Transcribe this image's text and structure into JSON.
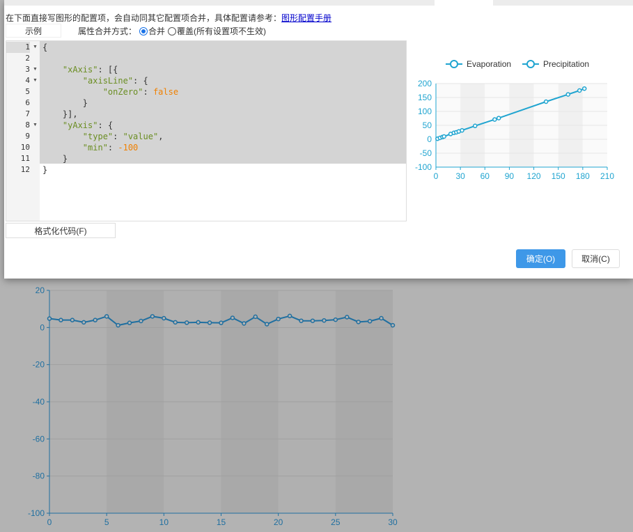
{
  "dialog": {
    "instruction": "在下面直接写图形的配置项，会自动同其它配置项合并，具体配置请参考：",
    "manual_link": "图形配置手册",
    "example_button": "示例",
    "merge_label": "属性合并方式：",
    "merge_option": "合并",
    "override_option": "覆盖(所有设置项不生效)",
    "format_button": "格式化代码(F)",
    "ok_button": "确定(O)",
    "cancel_button": "取消(C)"
  },
  "editor": {
    "line_numbers": [
      "1",
      "2",
      "3",
      "4",
      "5",
      "6",
      "7",
      "8",
      "9",
      "10",
      "11",
      "12"
    ],
    "fold_lines": [
      1,
      3,
      4,
      8
    ],
    "lines": [
      [
        [
          "p",
          "{"
        ]
      ],
      [],
      [
        [
          "p",
          "    "
        ],
        [
          "k",
          "\"xAxis\""
        ],
        [
          "p",
          ": [{"
        ]
      ],
      [
        [
          "p",
          "        "
        ],
        [
          "k",
          "\"axisLine\""
        ],
        [
          "p",
          ": {"
        ]
      ],
      [
        [
          "p",
          "            "
        ],
        [
          "k",
          "\"onZero\""
        ],
        [
          "p",
          ": "
        ],
        [
          "b",
          "false"
        ]
      ],
      [
        [
          "p",
          "        }"
        ]
      ],
      [
        [
          "p",
          "    }],"
        ]
      ],
      [
        [
          "p",
          "    "
        ],
        [
          "k",
          "\"yAxis\""
        ],
        [
          "p",
          ": {"
        ]
      ],
      [
        [
          "p",
          "        "
        ],
        [
          "k",
          "\"type\""
        ],
        [
          "p",
          ": "
        ],
        [
          "k",
          "\"value\""
        ],
        [
          "p",
          ","
        ]
      ],
      [
        [
          "p",
          "        "
        ],
        [
          "k",
          "\"min\""
        ],
        [
          "p",
          ": "
        ],
        [
          "b",
          "-100"
        ]
      ],
      [
        [
          "p",
          "    }"
        ]
      ],
      [
        [
          "p",
          "}"
        ]
      ]
    ]
  },
  "colors": {
    "accent": "#3e98e8",
    "preview_series": "#1fa4d0",
    "bg_series": "#1f6fa0"
  },
  "chart_data": [
    {
      "type": "scatter",
      "legend": [
        "Evaporation",
        "Precipitation"
      ],
      "legend_position": "top",
      "xlim": [
        0,
        210
      ],
      "xticks": [
        "0",
        "30",
        "60",
        "90",
        "120",
        "150",
        "180",
        "210"
      ],
      "ylim": [
        -100,
        200
      ],
      "yticks": [
        "200",
        "150",
        "100",
        "50",
        "0",
        "-50",
        "-100"
      ],
      "points": [
        [
          2,
          2
        ],
        [
          5,
          5
        ],
        [
          8,
          8
        ],
        [
          10,
          10
        ],
        [
          18,
          19
        ],
        [
          22,
          23
        ],
        [
          25,
          25
        ],
        [
          28,
          28
        ],
        [
          32,
          32
        ],
        [
          48,
          48
        ],
        [
          72,
          71
        ],
        [
          77,
          76
        ],
        [
          135,
          135
        ],
        [
          162,
          161
        ],
        [
          176,
          175
        ],
        [
          182,
          182
        ]
      ]
    },
    {
      "type": "line",
      "xlim": [
        0,
        30
      ],
      "xticks": [
        "0",
        "5",
        "10",
        "15",
        "20",
        "25",
        "30"
      ],
      "ylim": [
        -100,
        20
      ],
      "yticks": [
        "20",
        "0",
        "-20",
        "-40",
        "-60",
        "-80",
        "-100"
      ],
      "x": [
        0,
        1,
        2,
        3,
        4,
        5,
        6,
        7,
        8,
        9,
        10,
        11,
        12,
        13,
        14,
        15,
        16,
        17,
        18,
        19,
        20,
        21,
        22,
        23,
        24,
        25,
        26,
        27,
        28,
        29,
        30
      ],
      "values": [
        4.8,
        4,
        4,
        2.8,
        4,
        6,
        1.2,
        2.5,
        3.5,
        6,
        5,
        2.8,
        2.6,
        2.8,
        2.6,
        2.5,
        5.2,
        2.2,
        5.8,
        1.8,
        4.6,
        6.2,
        3.6,
        3.6,
        3.8,
        4.2,
        5.6,
        3,
        3.4,
        5,
        1.2
      ]
    }
  ]
}
